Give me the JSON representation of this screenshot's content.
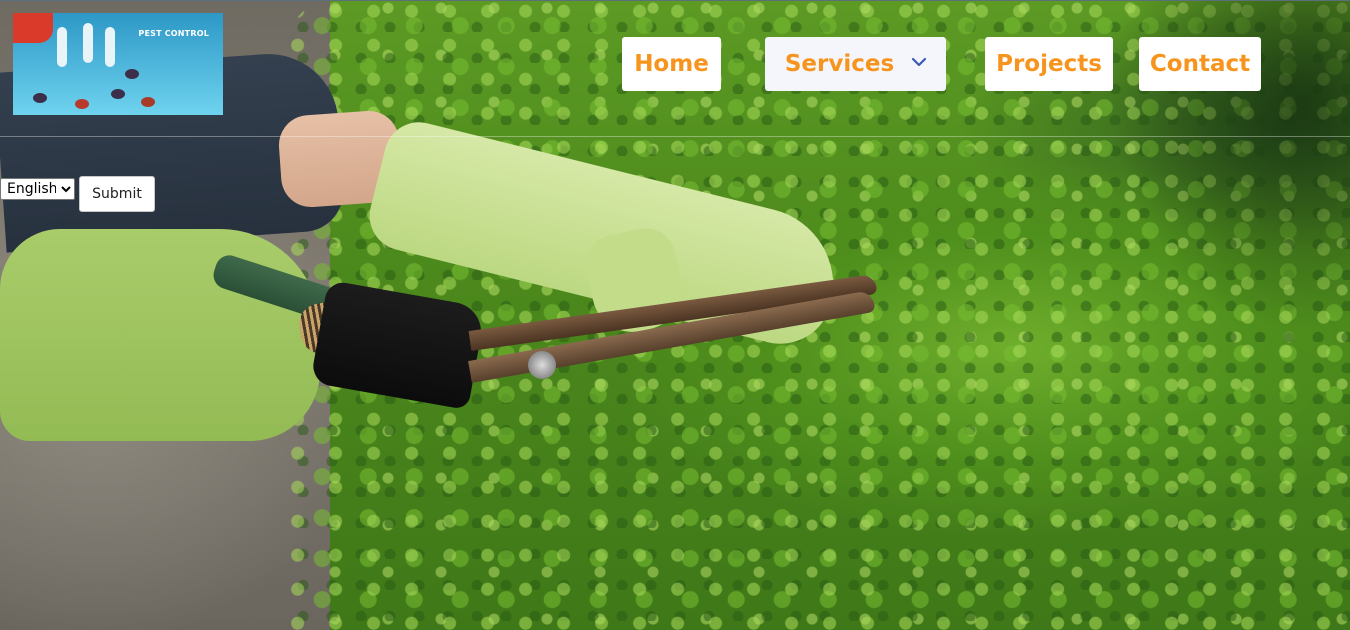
{
  "logo": {
    "text": "PEST CONTROL",
    "icon": "pest-control-logo"
  },
  "nav": {
    "items": [
      {
        "label": "Home"
      },
      {
        "label": "Services",
        "icon": "chevron-down-icon"
      },
      {
        "label": "Projects"
      },
      {
        "label": "Contact"
      }
    ],
    "color": "#f7941d"
  },
  "language": {
    "selected": "English",
    "options": [
      "English"
    ],
    "submit_label": "Submit"
  },
  "hero": {
    "image": "hands-trimming-hedge-with-shears"
  }
}
